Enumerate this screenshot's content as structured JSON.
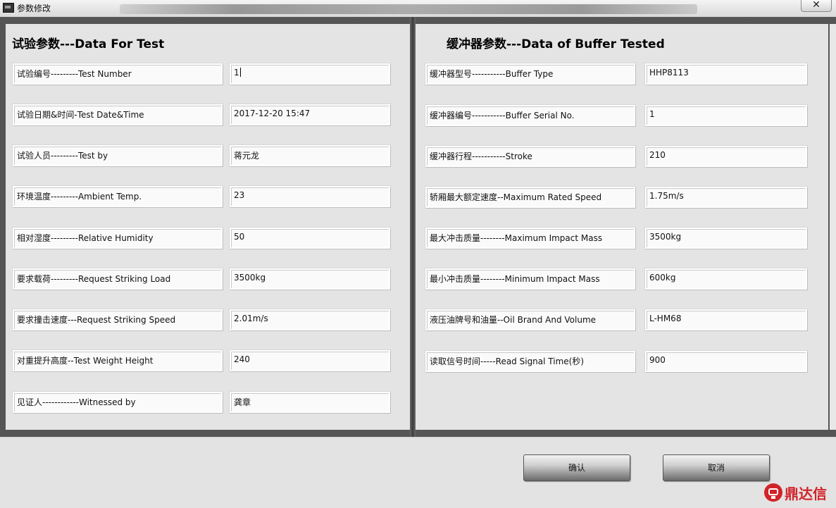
{
  "window": {
    "title": "参数修改",
    "close_glyph": "✕"
  },
  "left_panel": {
    "title": "试验参数---Data For Test",
    "rows": [
      {
        "label": "试验编号---------Test Number",
        "value": "1"
      },
      {
        "label": "试验日期&时间-Test Date&Time",
        "value": "2017-12-20 15:47"
      },
      {
        "label": "试验人员---------Test by",
        "value": "蒋元龙"
      },
      {
        "label": "环境温度---------Ambient Temp.",
        "value": "23"
      },
      {
        "label": "相对湿度---------Relative Humidity",
        "value": "50"
      },
      {
        "label": "要求载荷---------Request Striking Load",
        "value": "3500kg"
      },
      {
        "label": "要求撞击速度---Request Striking Speed",
        "value": "2.01m/s"
      },
      {
        "label": "对重提升高度--Test Weight Height",
        "value": "240"
      },
      {
        "label": "见证人------------Witnessed by",
        "value": "龚章"
      }
    ]
  },
  "right_panel": {
    "title": "缓冲器参数---Data of Buffer Tested",
    "rows": [
      {
        "label": "缓冲器型号-----------Buffer Type",
        "value": "HHP8113"
      },
      {
        "label": "缓冲器编号-----------Buffer Serial No.",
        "value": "1"
      },
      {
        "label": "缓冲器行程-----------Stroke",
        "value": "210"
      },
      {
        "label": "轿厢最大额定速度--Maximum Rated Speed",
        "value": "1.75m/s"
      },
      {
        "label": "最大冲击质量--------Maximum Impact Mass",
        "value": "3500kg"
      },
      {
        "label": "最小冲击质量--------Minimum Impact Mass",
        "value": "600kg"
      },
      {
        "label": "液压油牌号和油量--Oil Brand And Volume",
        "value": "L-HM68"
      },
      {
        "label": "读取信号时间-----Read Signal Time(秒)",
        "value": "900"
      }
    ]
  },
  "buttons": {
    "confirm": "确认",
    "cancel": "取消"
  },
  "watermark": {
    "text": "鼎达信",
    "color": "#d2232a"
  }
}
